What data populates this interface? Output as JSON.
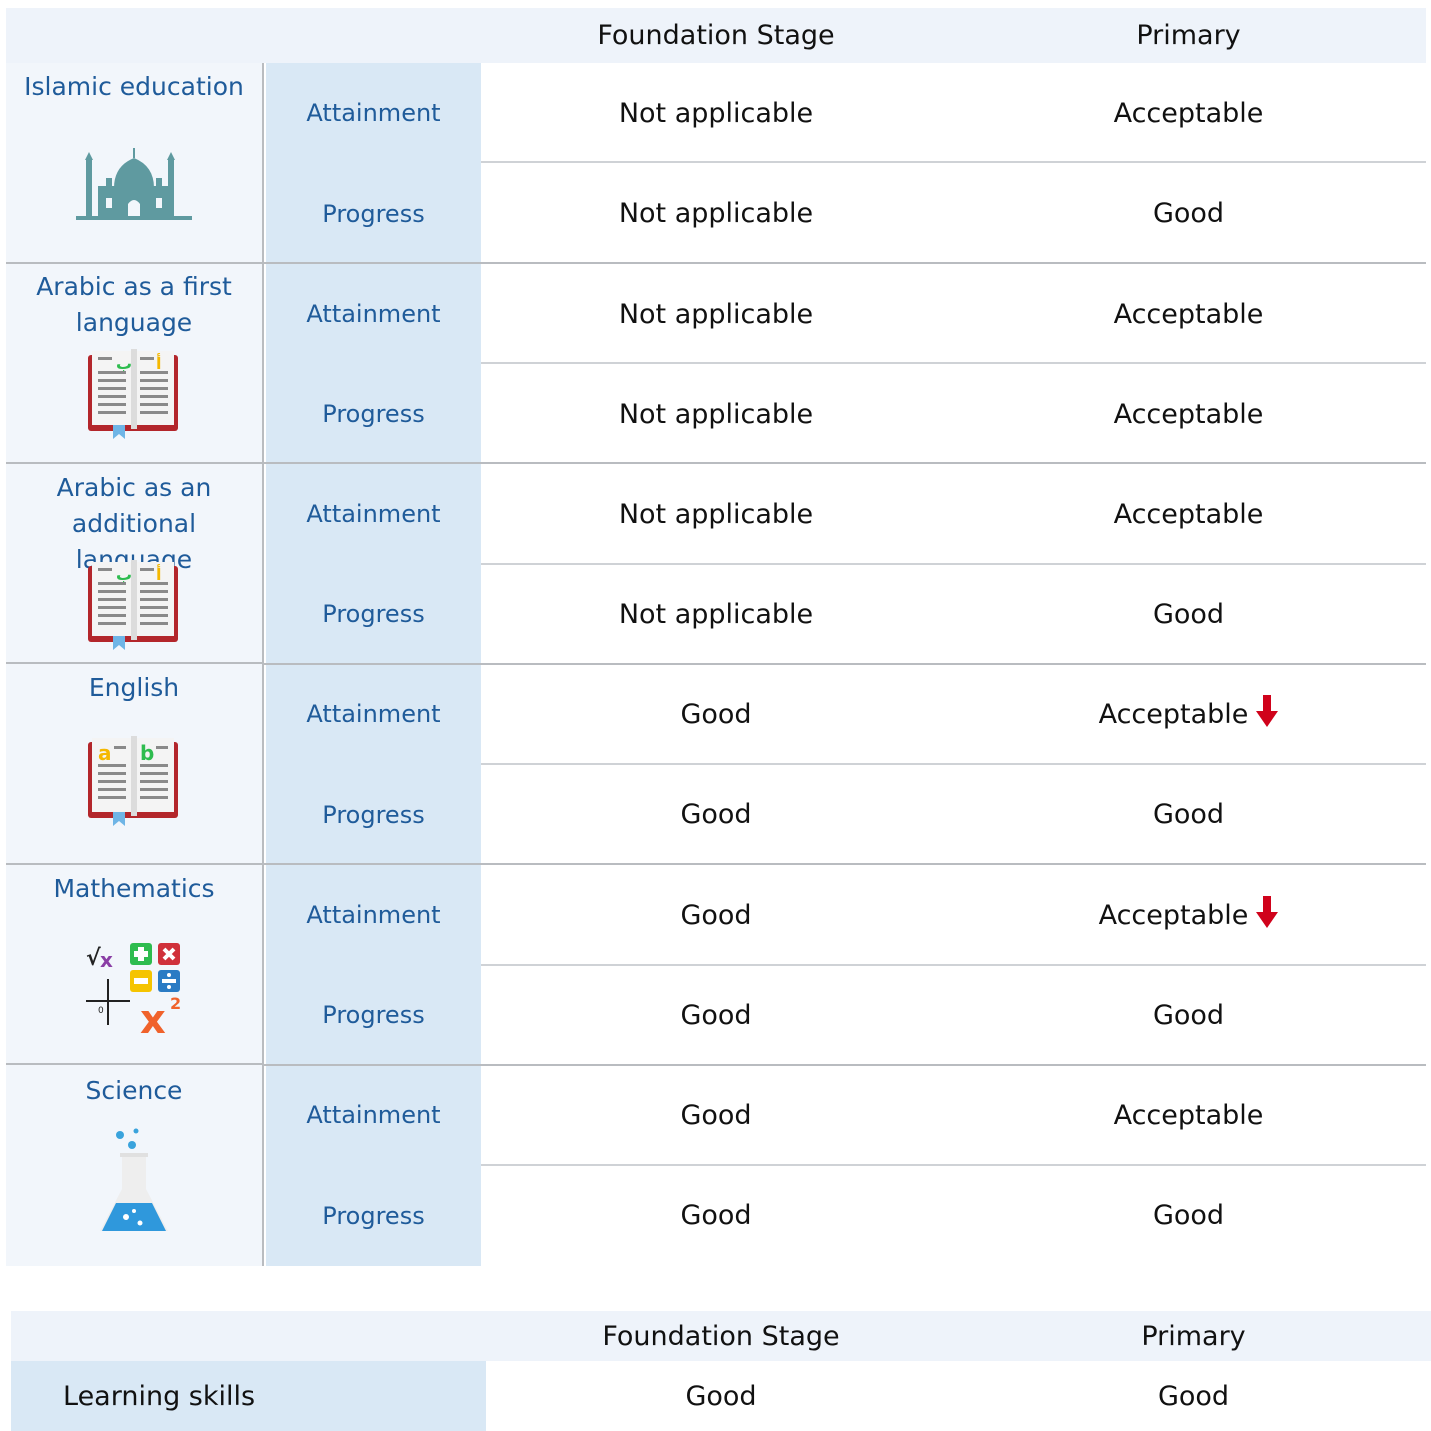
{
  "table1": {
    "headers": {
      "foundation": "Foundation Stage",
      "primary": "Primary"
    },
    "subjects": [
      {
        "name": "Islamic education",
        "icon": "mosque-icon",
        "rows": [
          {
            "type": "Attainment",
            "foundation": "Not applicable",
            "primary": "Acceptable",
            "primary_trend": ""
          },
          {
            "type": "Progress",
            "foundation": "Not applicable",
            "primary": "Good",
            "primary_trend": ""
          }
        ]
      },
      {
        "name": "Arabic as a first language",
        "icon": "arabic-book-icon",
        "rows": [
          {
            "type": "Attainment",
            "foundation": "Not applicable",
            "primary": "Acceptable",
            "primary_trend": ""
          },
          {
            "type": "Progress",
            "foundation": "Not applicable",
            "primary": "Acceptable",
            "primary_trend": ""
          }
        ]
      },
      {
        "name": "Arabic as an additional language",
        "icon": "arabic-book-icon",
        "rows": [
          {
            "type": "Attainment",
            "foundation": "Not applicable",
            "primary": "Acceptable",
            "primary_trend": ""
          },
          {
            "type": "Progress",
            "foundation": "Not applicable",
            "primary": "Good",
            "primary_trend": ""
          }
        ]
      },
      {
        "name": "English",
        "icon": "english-book-icon",
        "rows": [
          {
            "type": "Attainment",
            "foundation": "Good",
            "primary": "Acceptable",
            "primary_trend": "down"
          },
          {
            "type": "Progress",
            "foundation": "Good",
            "primary": "Good",
            "primary_trend": ""
          }
        ]
      },
      {
        "name": "Mathematics",
        "icon": "math-symbols-icon",
        "rows": [
          {
            "type": "Attainment",
            "foundation": "Good",
            "primary": "Acceptable",
            "primary_trend": "down"
          },
          {
            "type": "Progress",
            "foundation": "Good",
            "primary": "Good",
            "primary_trend": ""
          }
        ]
      },
      {
        "name": "Science",
        "icon": "flask-icon",
        "rows": [
          {
            "type": "Attainment",
            "foundation": "Good",
            "primary": "Acceptable",
            "primary_trend": ""
          },
          {
            "type": "Progress",
            "foundation": "Good",
            "primary": "Good",
            "primary_trend": ""
          }
        ]
      }
    ]
  },
  "table2": {
    "headers": {
      "foundation": "Foundation Stage",
      "primary": "Primary"
    },
    "rows": [
      {
        "label": "Learning skills",
        "foundation": "Good",
        "primary": "Good"
      }
    ]
  },
  "colors": {
    "header_bg": "#eef3fa",
    "subject_bg": "#f2f6fb",
    "type_bg": "#d9e8f5",
    "label_text": "#1f5b9a",
    "trend_down": "#d0021b"
  }
}
